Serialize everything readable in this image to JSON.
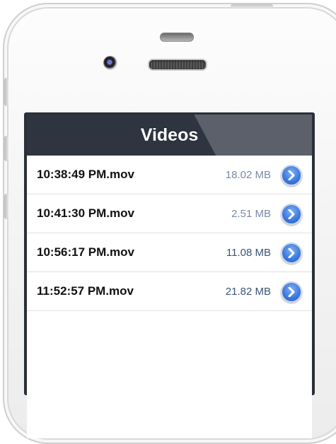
{
  "navbar": {
    "title": "Videos"
  },
  "videos": [
    {
      "name": "10:38:49 PM.mov",
      "size": "18.02 MB"
    },
    {
      "name": "10:41:30 PM.mov",
      "size": "2.51 MB"
    },
    {
      "name": "10:56:17 PM.mov",
      "size": "11.08 MB"
    },
    {
      "name": "11:52:57 PM.mov",
      "size": "21.82 MB"
    }
  ],
  "colors": {
    "navbar": "#2e3440",
    "size_text_light": "#7a8aa6",
    "size_text_dark": "#3c5378",
    "disclosure_blue": "#3a77de"
  },
  "icons": [
    "front-camera-icon",
    "earpiece-speaker-icon",
    "disclosure-arrow-icon"
  ]
}
